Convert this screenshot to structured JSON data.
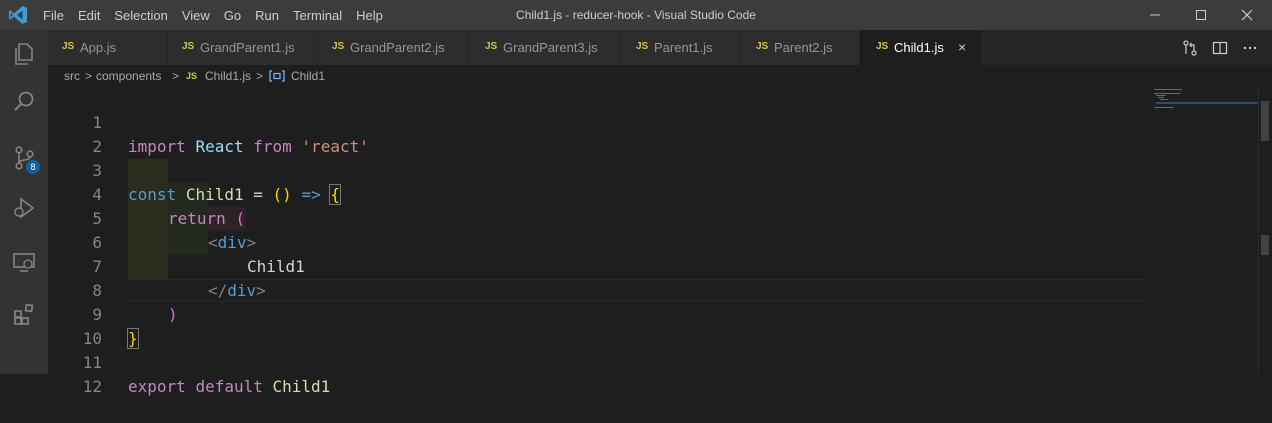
{
  "titlebar": {
    "menu": [
      "File",
      "Edit",
      "Selection",
      "View",
      "Go",
      "Run",
      "Terminal",
      "Help"
    ],
    "title": "Child1.js - reducer-hook - Visual Studio Code"
  },
  "activity_bar": {
    "source_control_badge": "8"
  },
  "tabs": [
    {
      "badge": "JS",
      "label": "App.js"
    },
    {
      "badge": "JS",
      "label": "GrandParent1.js"
    },
    {
      "badge": "JS",
      "label": "GrandParent2.js"
    },
    {
      "badge": "JS",
      "label": "GrandParent3.js"
    },
    {
      "badge": "JS",
      "label": "Parent1.js"
    },
    {
      "badge": "JS",
      "label": "Parent2.js"
    },
    {
      "badge": "JS",
      "label": "Child1.js",
      "active": true,
      "close": "×"
    }
  ],
  "breadcrumb": {
    "items": [
      "src",
      "components",
      "Child1.js",
      "Child1"
    ],
    "separator": ">",
    "file_badge": "JS"
  },
  "editor": {
    "line_numbers": [
      "1",
      "2",
      "3",
      "4",
      "5",
      "6",
      "7",
      "8",
      "9",
      "10",
      "11",
      "12"
    ],
    "code": {
      "l1": {
        "kw": "import",
        "name": "React",
        "from": "from",
        "str": "'react'"
      },
      "l3": {
        "kw": "const",
        "name": "Child1",
        "eq": "=",
        "parens": "()",
        "arrow": "=>",
        "brace": "{"
      },
      "l4": {
        "kw": "return",
        "paren": "("
      },
      "l5": {
        "open": "<",
        "tag": "div",
        "close": ">"
      },
      "l6": {
        "text": "Child1"
      },
      "l7": {
        "open": "</",
        "tag": "div",
        "close": ">"
      },
      "l8": {
        "paren": ")"
      },
      "l9": {
        "brace": "}"
      },
      "l11": {
        "kw1": "export",
        "kw2": "default",
        "name": "Child1"
      }
    }
  },
  "colors": {
    "titlebar": "#3c3c3c",
    "activity_bar": "#333333",
    "editor_bg": "#1e1e1e",
    "tab_inactive": "#2d2d2d",
    "js_badge": "#cbcb41",
    "accent": "#0e639c"
  }
}
